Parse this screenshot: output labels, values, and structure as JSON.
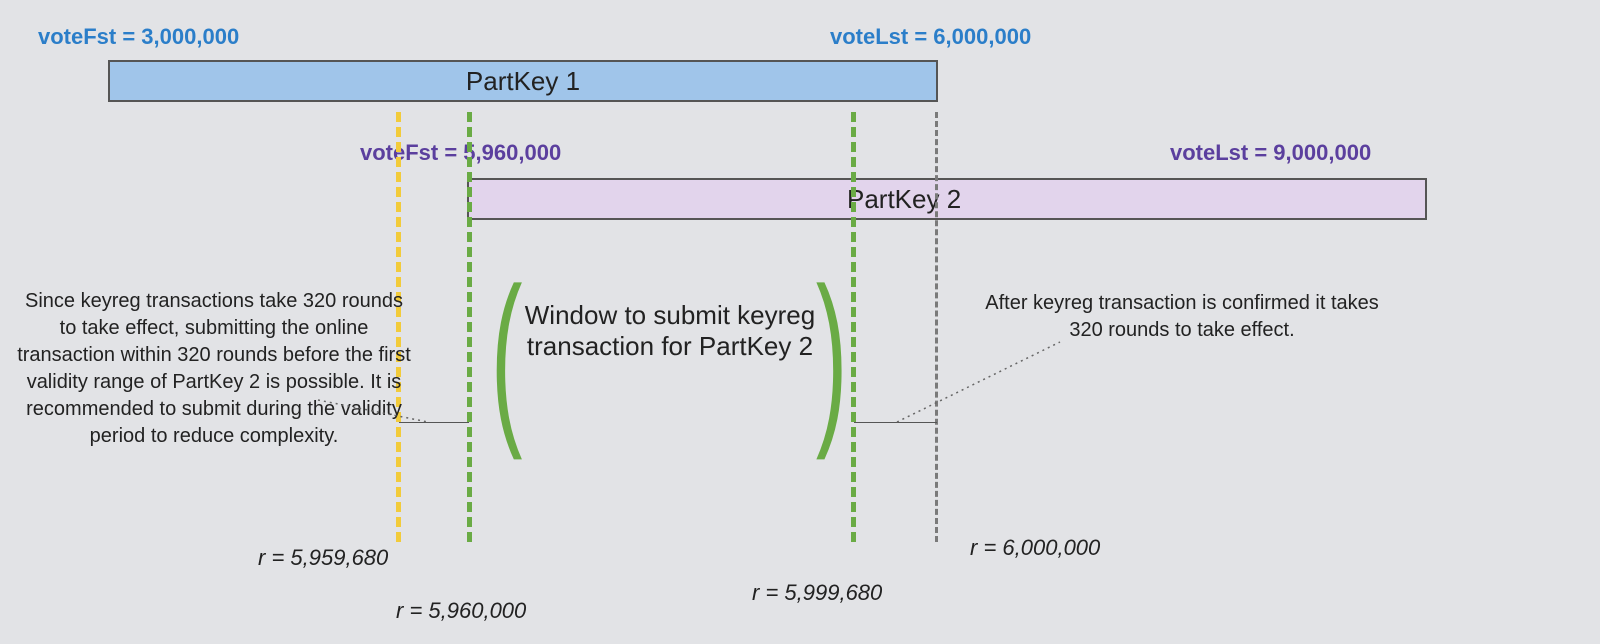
{
  "partkey1": {
    "label": "PartKey 1",
    "voteFst_label": "voteFst = 3,000,000",
    "voteLst_label": "voteLst = 6,000,000"
  },
  "partkey2": {
    "label": "PartKey 2",
    "voteFst_label": "voteFst = 5,960,000",
    "voteLst_label": "voteLst = 9,000,000"
  },
  "window": {
    "text": "Window to submit keyreg transaction for PartKey 2"
  },
  "notes": {
    "left": "Since keyreg transactions take 320 rounds to take effect, submitting the online transaction within 320 rounds before the first validity range of PartKey 2 is possible. It is recommended to submit during the validity period to reduce complexity.",
    "right": "After keyreg transaction is confirmed it takes 320 rounds to take effect."
  },
  "rounds": {
    "r1": "r = 5,959,680",
    "r2": "r = 5,960,000",
    "r3": "r = 5,999,680",
    "r4": "r = 6,000,000"
  }
}
